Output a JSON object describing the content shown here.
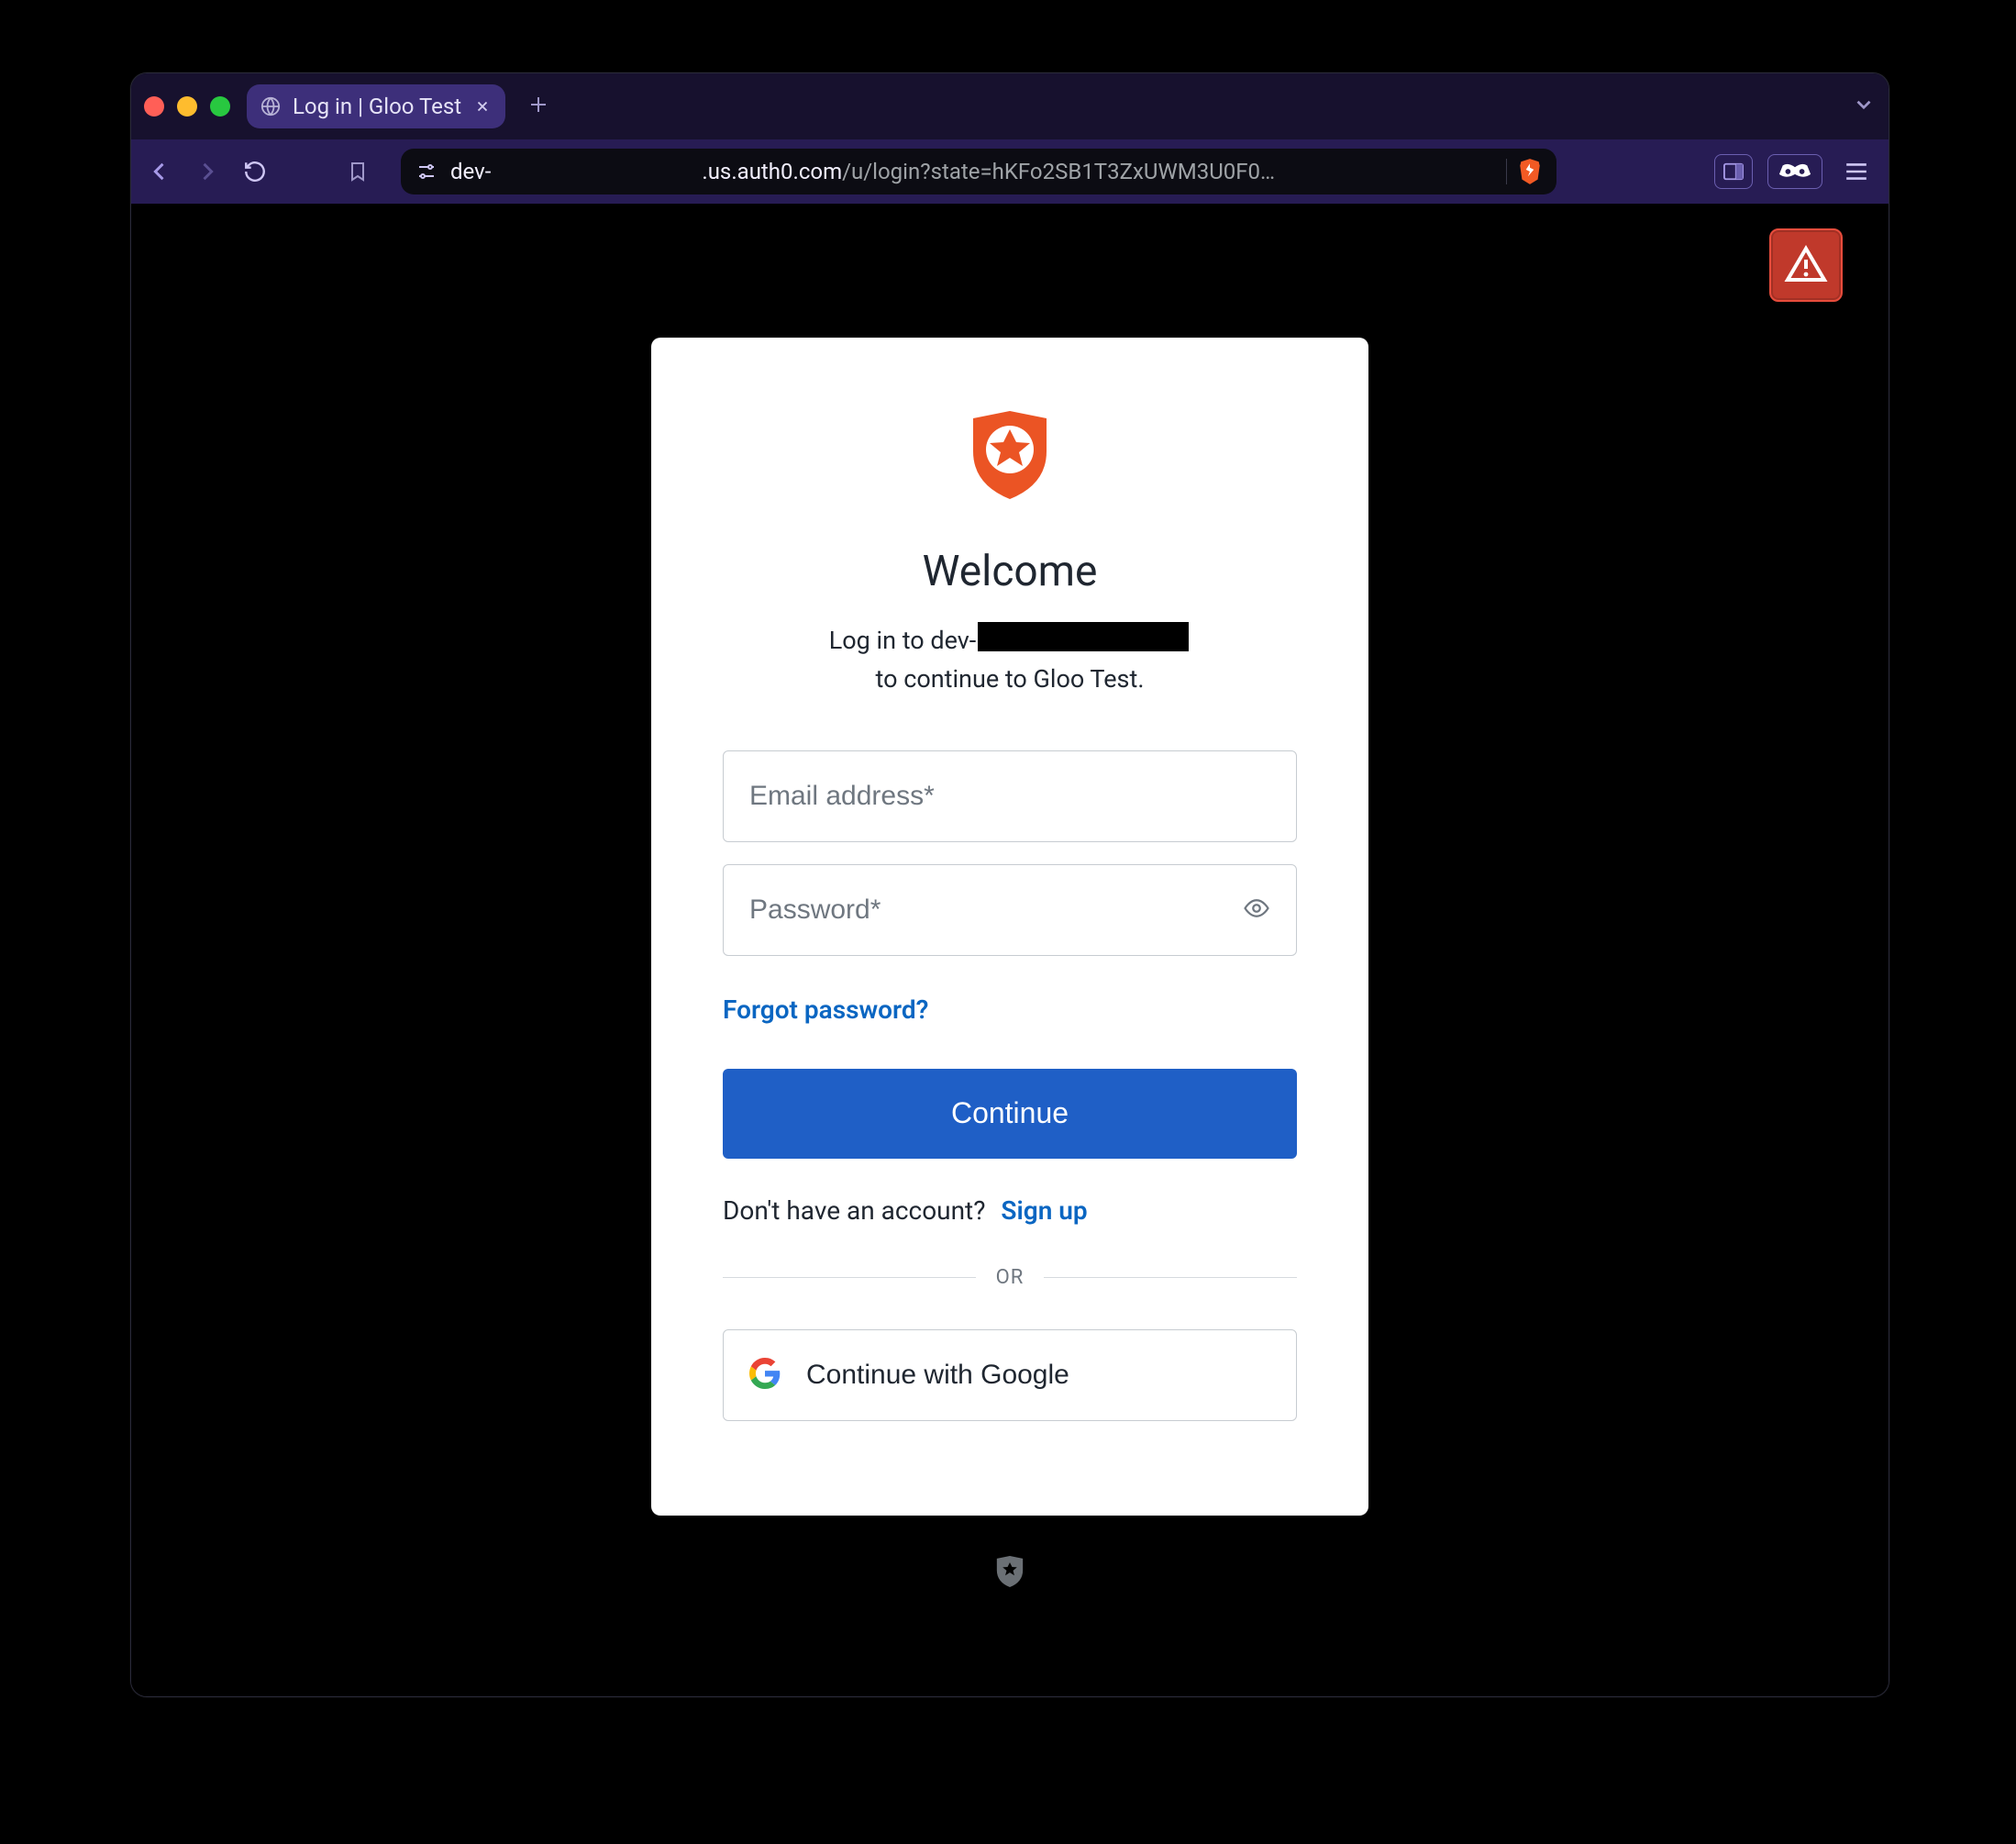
{
  "browser": {
    "tab_title": "Log in | Gloo Test",
    "url_prefix": "dev-",
    "url_domain_suffix": ".us.auth0.com",
    "url_path": "/u/login?state=hKFo2SB1T3ZxUWM3U0F0…"
  },
  "login": {
    "title": "Welcome",
    "subtitle_pre": "Log in to dev-",
    "subtitle_post": "to continue to Gloo Test.",
    "email_placeholder": "Email address*",
    "password_placeholder": "Password*",
    "forgot_label": "Forgot password?",
    "continue_label": "Continue",
    "signup_prompt": "Don't have an account?",
    "signup_link": "Sign up",
    "or_label": "OR",
    "google_label": "Continue with Google"
  }
}
